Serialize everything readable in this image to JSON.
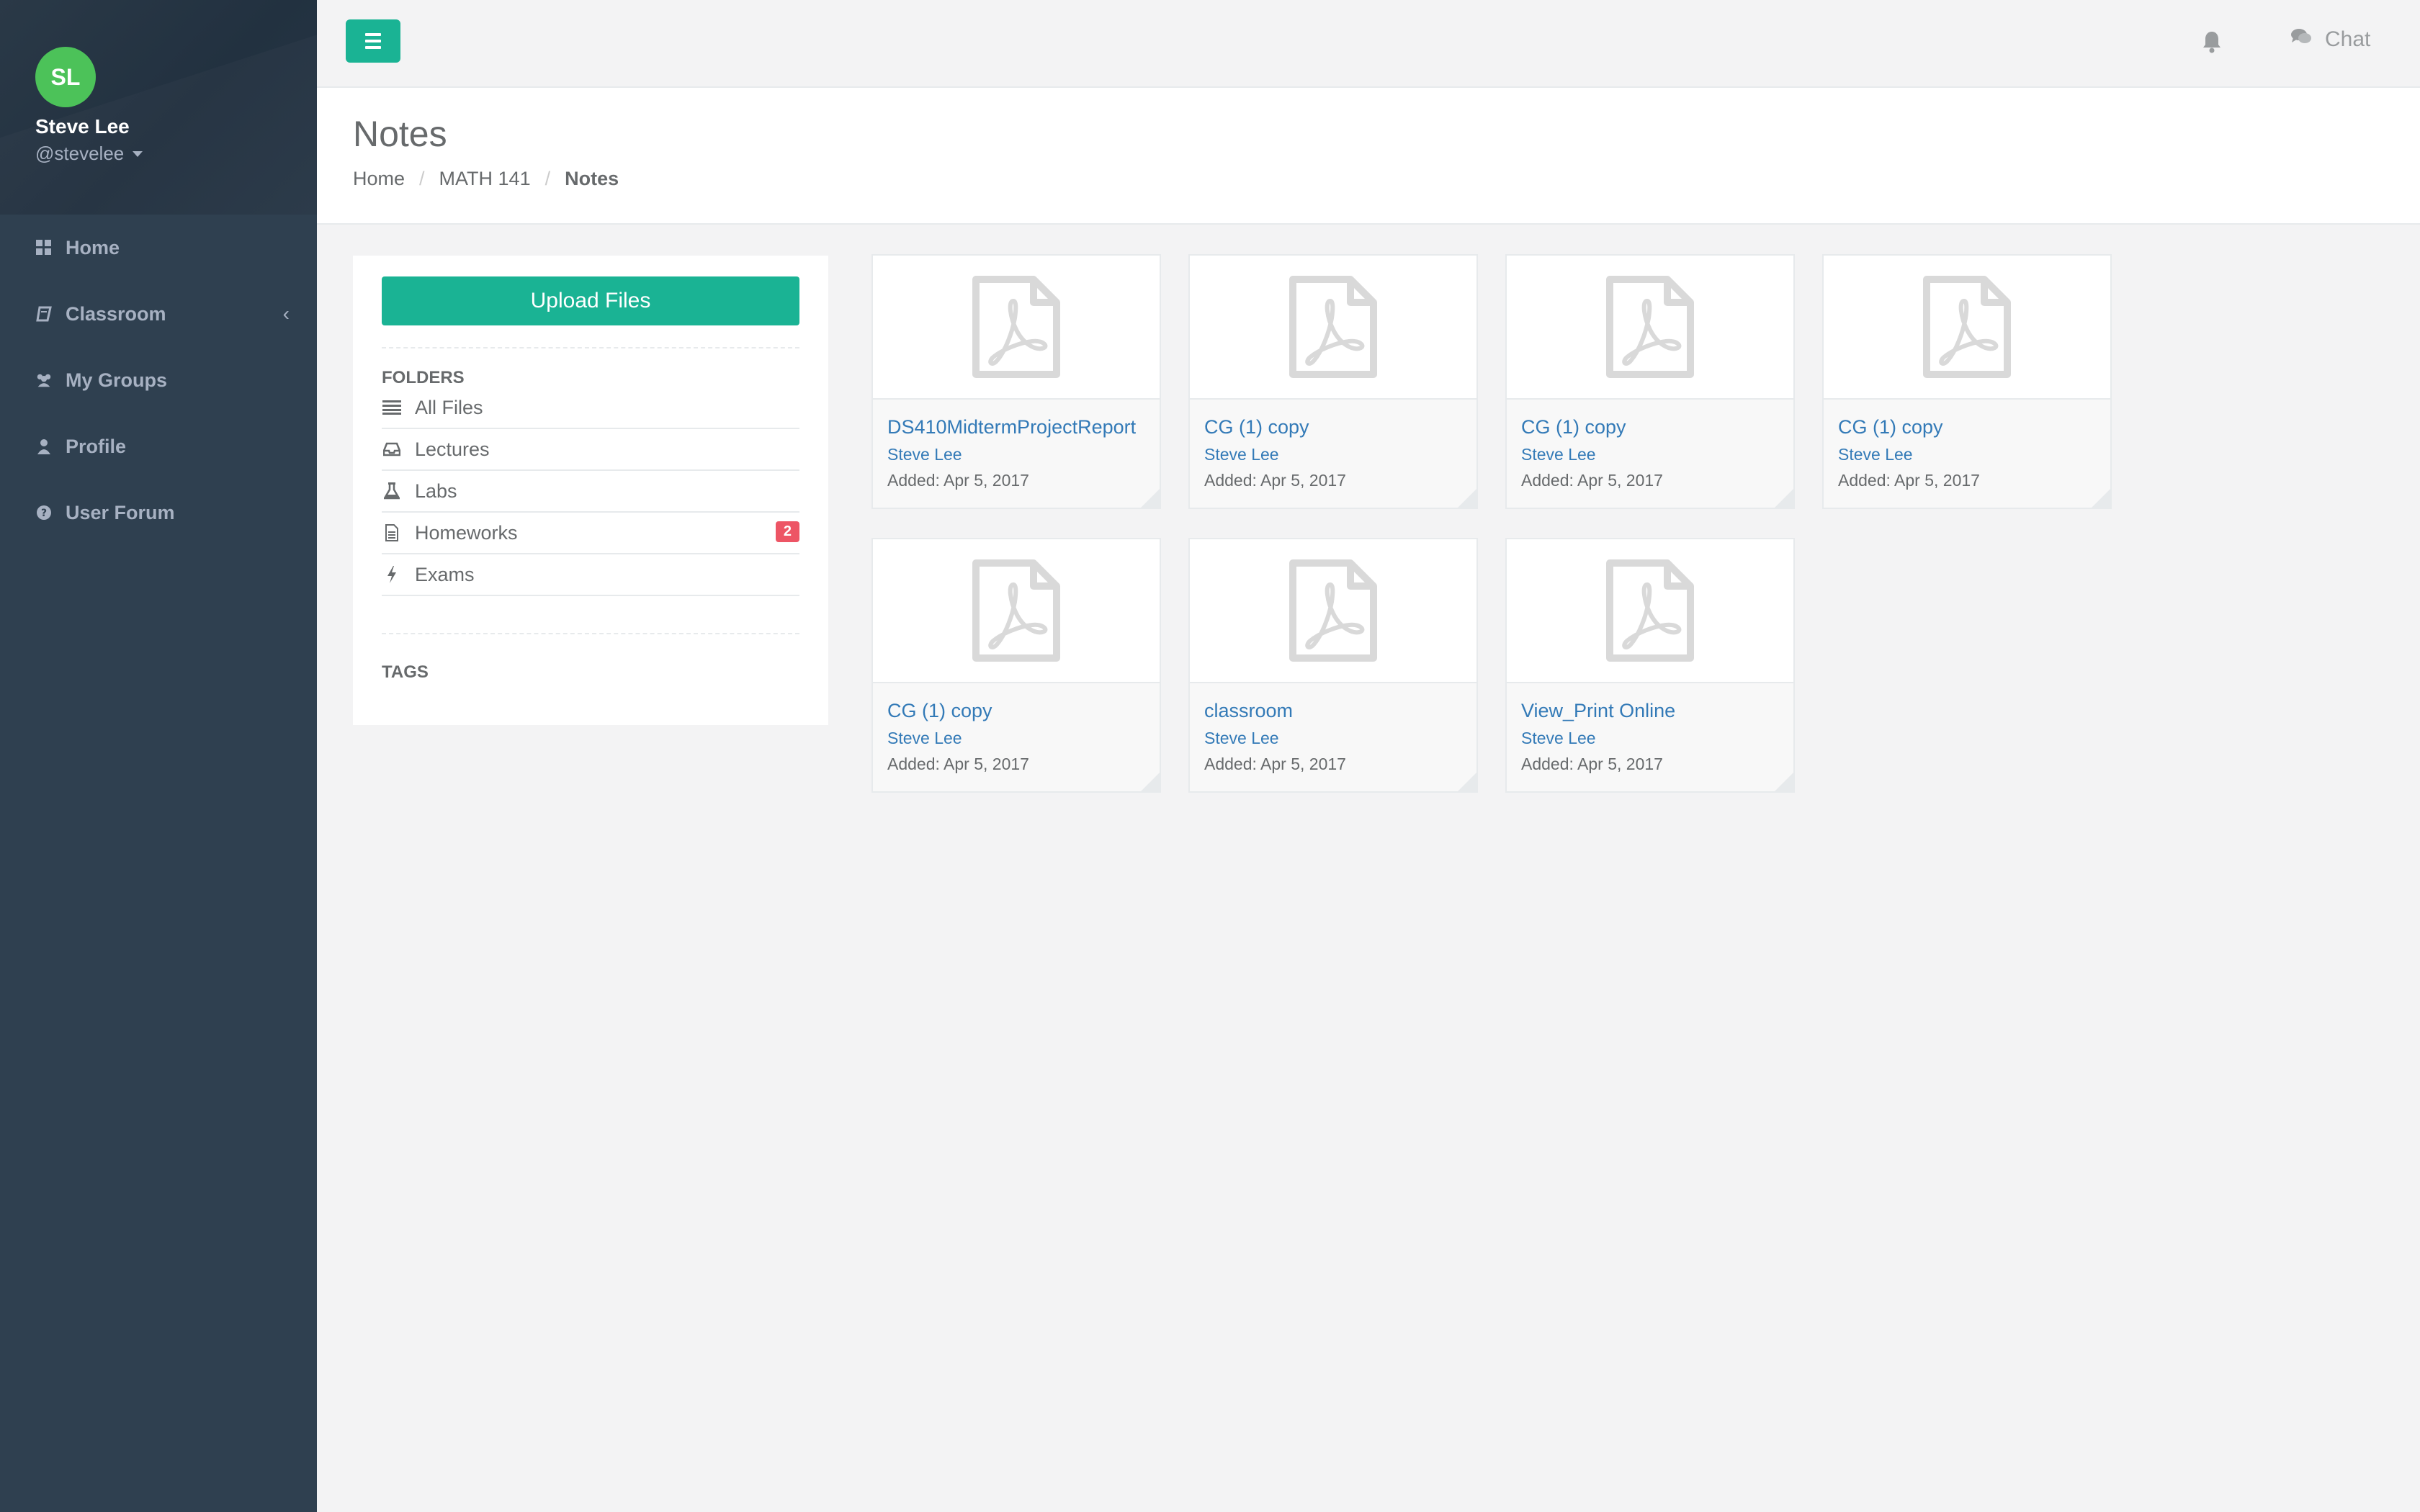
{
  "user": {
    "initials": "SL",
    "name": "Steve Lee",
    "handle": "@stevelee"
  },
  "nav": [
    {
      "label": "Home",
      "icon": "th-large-icon"
    },
    {
      "label": "Classroom",
      "icon": "book-icon",
      "chevron": "‹"
    },
    {
      "label": "My Groups",
      "icon": "users-icon"
    },
    {
      "label": "Profile",
      "icon": "user-icon"
    },
    {
      "label": "User Forum",
      "icon": "question-circle-icon"
    }
  ],
  "topbar": {
    "chat_label": "Chat"
  },
  "page": {
    "title": "Notes",
    "breadcrumb": [
      "Home",
      "MATH 141",
      "Notes"
    ],
    "separator": "/"
  },
  "folders_panel": {
    "upload_label": "Upload Files",
    "folders_title": "FOLDERS",
    "tags_title": "TAGS",
    "folders": [
      {
        "label": "All Files",
        "icon": "list-icon"
      },
      {
        "label": "Lectures",
        "icon": "inbox-icon"
      },
      {
        "label": "Labs",
        "icon": "flask-icon"
      },
      {
        "label": "Homeworks",
        "icon": "file-text-icon",
        "badge": "2"
      },
      {
        "label": "Exams",
        "icon": "bolt-icon"
      }
    ]
  },
  "files": [
    {
      "name": "DS410MidtermProjectReport",
      "author": "Steve Lee",
      "added": "Added: Apr 5, 2017"
    },
    {
      "name": "CG (1) copy",
      "author": "Steve Lee",
      "added": "Added: Apr 5, 2017"
    },
    {
      "name": "CG (1) copy",
      "author": "Steve Lee",
      "added": "Added: Apr 5, 2017"
    },
    {
      "name": "CG (1) copy",
      "author": "Steve Lee",
      "added": "Added: Apr 5, 2017"
    },
    {
      "name": "CG (1) copy",
      "author": "Steve Lee",
      "added": "Added: Apr 5, 2017"
    },
    {
      "name": "classroom",
      "author": "Steve Lee",
      "added": "Added: Apr 5, 2017"
    },
    {
      "name": "View_Print Online",
      "author": "Steve Lee",
      "added": "Added: Apr 5, 2017"
    }
  ],
  "colors": {
    "sidebar": "#2f4050",
    "accent": "#1ab394",
    "avatar": "#4cc259",
    "link": "#337ab7",
    "badge": "#ed5565"
  }
}
